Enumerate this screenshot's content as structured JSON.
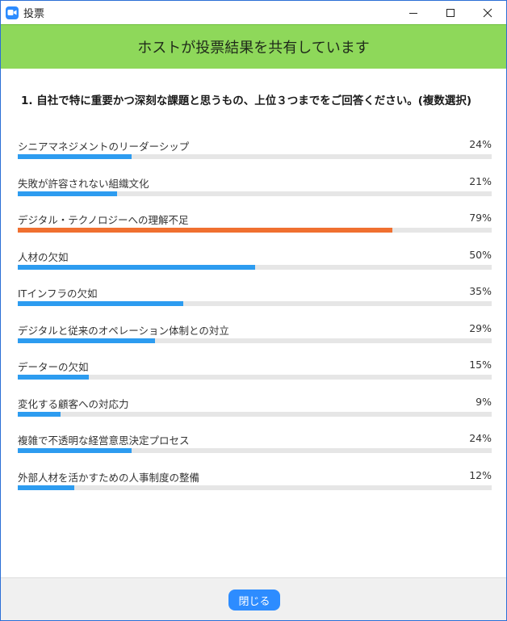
{
  "window": {
    "title": "投票",
    "controls": [
      "minimize-icon",
      "maximize-icon",
      "close-icon"
    ]
  },
  "banner": {
    "text": "ホストが投票結果を共有しています",
    "color": "#8ed85a"
  },
  "question": "1. 自社で特に重要かつ深刻な課題と思うもの、上位３つまでをご回答ください。(複数選択)",
  "options": [
    {
      "label": "シニアマネジメントのリーダーシップ",
      "percent": "24%",
      "value": 24,
      "highlight": false
    },
    {
      "label": "失敗が許容されない組織文化",
      "percent": "21%",
      "value": 21,
      "highlight": false
    },
    {
      "label": "デジタル・テクノロジーへの理解不足",
      "percent": "79%",
      "value": 79,
      "highlight": true
    },
    {
      "label": "人材の欠如",
      "percent": "50%",
      "value": 50,
      "highlight": false
    },
    {
      "label": "ITインフラの欠如",
      "percent": "35%",
      "value": 35,
      "highlight": false
    },
    {
      "label": "デジタルと従来のオペレーション体制との対立",
      "percent": "29%",
      "value": 29,
      "highlight": false
    },
    {
      "label": "データーの欠如",
      "percent": "15%",
      "value": 15,
      "highlight": false
    },
    {
      "label": "変化する顧客への対応力",
      "percent": "9%",
      "value": 9,
      "highlight": false
    },
    {
      "label": "複雑で不透明な経営意思決定プロセス",
      "percent": "24%",
      "value": 24,
      "highlight": false
    },
    {
      "label": "外部人材を活かすための人事制度の整備",
      "percent": "12%",
      "value": 12,
      "highlight": false
    }
  ],
  "colors": {
    "bar": "#2d9cf0",
    "highlight": "#f07030",
    "track": "#e6e6e6"
  },
  "footer": {
    "close_label": "閉じる"
  }
}
